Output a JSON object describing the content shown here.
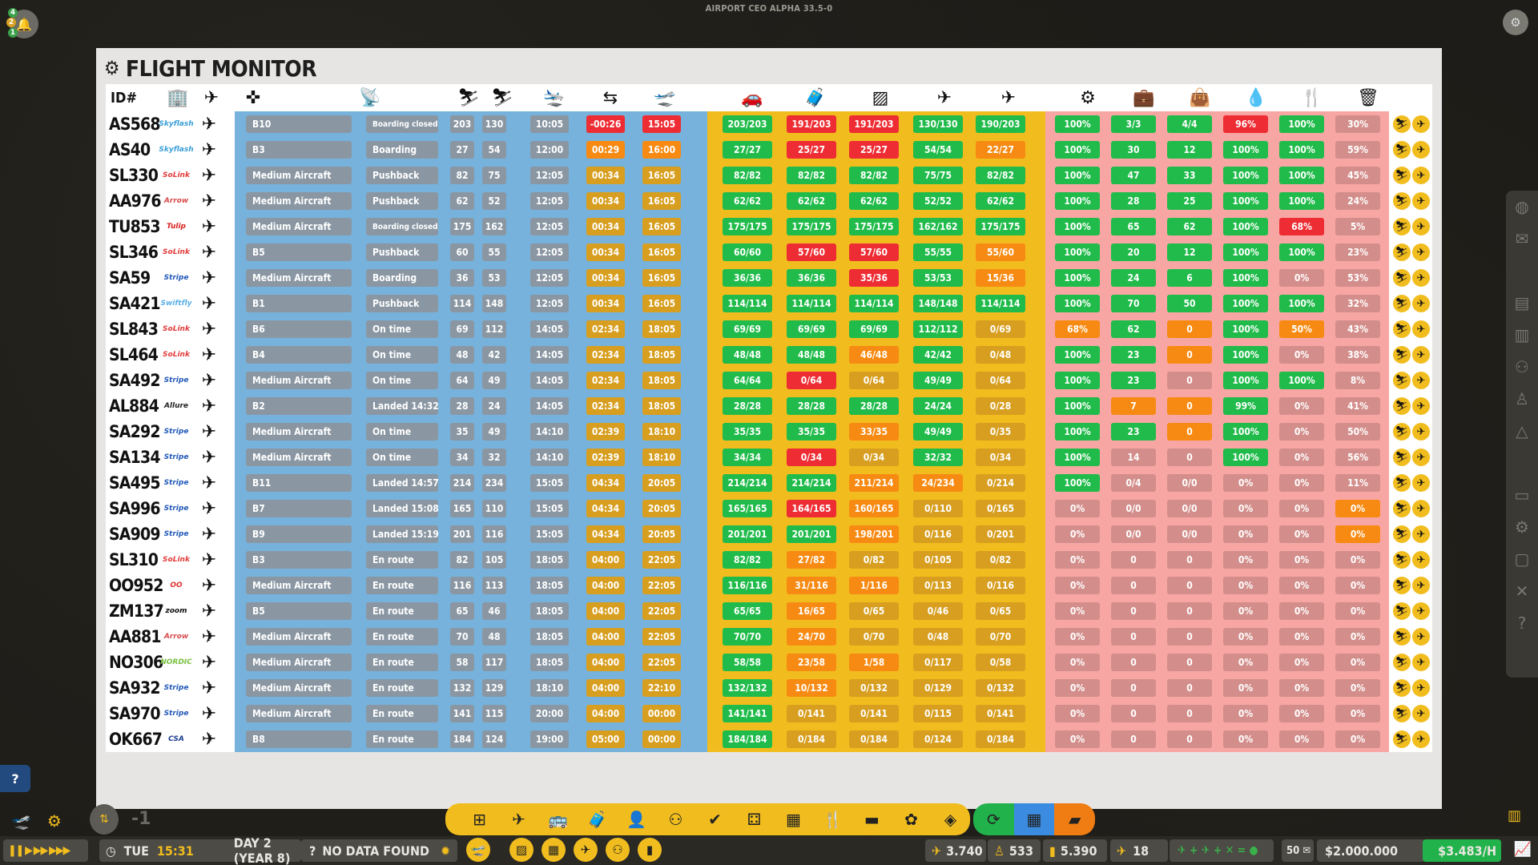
{
  "app": {
    "version_label": "AIRPORT CEO ALPHA 33.5-0"
  },
  "panel": {
    "title": "FLIGHT MONITOR"
  },
  "header": {
    "id_label": "ID#"
  },
  "columns_icons": [
    "terminal-icon",
    "aircraft-type-icon",
    "stand-icon",
    "satellite-icon",
    "passengers-boarding-icon",
    "passengers-deboarding-icon",
    "arrival-icon",
    "turnaround-icon",
    "departure-icon",
    "car-icon",
    "baggage-icon",
    "cleaning-icon",
    "refuel-icon",
    "catering-icon",
    "service-cog-icon",
    "suitcase-icon",
    "bag-icon",
    "fuel-drop-icon",
    "cutlery-icon",
    "trash-icon"
  ],
  "flights": [
    {
      "id": "AS568",
      "airline": "Skyflash",
      "stand": "B10",
      "status": "Boarding closed",
      "pax_in": "203",
      "pax_out": "130",
      "arr": "10:05",
      "turn": "-00:26",
      "dep": "15:05",
      "c1": "203/203",
      "c2": "191/203",
      "c3": "191/203",
      "c4": "130/130",
      "c5": "190/203",
      "s1": "100%",
      "s2": "3/3",
      "s3": "4/4",
      "s4": "96%",
      "s5": "100%",
      "s6": "30%",
      "st": [
        "g",
        "g",
        "g",
        "g",
        "g",
        "bad",
        "bad",
        "ok",
        "bad",
        "bad",
        "ok",
        "ok",
        "ok",
        "ok",
        "ok",
        "bad",
        "ok",
        "gv"
      ]
    },
    {
      "id": "AS40",
      "airline": "Skyflash",
      "stand": "B3",
      "status": "Boarding",
      "pax_in": "27",
      "pax_out": "54",
      "arr": "12:00",
      "turn": "00:29",
      "dep": "16:00",
      "c1": "27/27",
      "c2": "25/27",
      "c3": "25/27",
      "c4": "54/54",
      "c5": "22/27",
      "s1": "100%",
      "s2": "30",
      "s3": "12",
      "s4": "100%",
      "s5": "100%",
      "s6": "59%",
      "st": [
        "g",
        "g",
        "g",
        "g",
        "g",
        "warn",
        "warn",
        "ok",
        "bad",
        "bad",
        "ok",
        "warn",
        "ok",
        "ok",
        "ok",
        "ok",
        "ok",
        "gv"
      ]
    },
    {
      "id": "SL330",
      "airline": "SoLink",
      "stand": "Medium Aircraft",
      "status": "Pushback",
      "pax_in": "82",
      "pax_out": "75",
      "arr": "12:05",
      "turn": "00:34",
      "dep": "16:05",
      "c1": "82/82",
      "c2": "82/82",
      "c3": "82/82",
      "c4": "75/75",
      "c5": "82/82",
      "s1": "100%",
      "s2": "47",
      "s3": "33",
      "s4": "100%",
      "s5": "100%",
      "s6": "45%",
      "st": [
        "g",
        "g",
        "g",
        "g",
        "g",
        "gy",
        "gy",
        "ok",
        "ok",
        "ok",
        "ok",
        "ok",
        "ok",
        "ok",
        "ok",
        "ok",
        "ok",
        "gv"
      ]
    },
    {
      "id": "AA976",
      "airline": "Arrow",
      "stand": "Medium Aircraft",
      "status": "Pushback",
      "pax_in": "62",
      "pax_out": "52",
      "arr": "12:05",
      "turn": "00:34",
      "dep": "16:05",
      "c1": "62/62",
      "c2": "62/62",
      "c3": "62/62",
      "c4": "52/52",
      "c5": "62/62",
      "s1": "100%",
      "s2": "28",
      "s3": "25",
      "s4": "100%",
      "s5": "100%",
      "s6": "24%",
      "st": [
        "g",
        "g",
        "g",
        "g",
        "g",
        "gy",
        "gy",
        "ok",
        "ok",
        "ok",
        "ok",
        "ok",
        "ok",
        "ok",
        "ok",
        "ok",
        "ok",
        "gv"
      ]
    },
    {
      "id": "TU853",
      "airline": "Tulip",
      "stand": "Medium Aircraft",
      "status": "Boarding closed",
      "pax_in": "175",
      "pax_out": "162",
      "arr": "12:05",
      "turn": "00:34",
      "dep": "16:05",
      "c1": "175/175",
      "c2": "175/175",
      "c3": "175/175",
      "c4": "162/162",
      "c5": "175/175",
      "s1": "100%",
      "s2": "65",
      "s3": "62",
      "s4": "100%",
      "s5": "68%",
      "s6": "5%",
      "st": [
        "g",
        "g",
        "g",
        "g",
        "g",
        "gy",
        "gy",
        "ok",
        "ok",
        "ok",
        "ok",
        "ok",
        "ok",
        "ok",
        "ok",
        "ok",
        "bad",
        "gv"
      ]
    },
    {
      "id": "SL346",
      "airline": "SoLink",
      "stand": "B5",
      "status": "Pushback",
      "pax_in": "60",
      "pax_out": "55",
      "arr": "12:05",
      "turn": "00:34",
      "dep": "16:05",
      "c1": "60/60",
      "c2": "57/60",
      "c3": "57/60",
      "c4": "55/55",
      "c5": "55/60",
      "s1": "100%",
      "s2": "20",
      "s3": "12",
      "s4": "100%",
      "s5": "100%",
      "s6": "23%",
      "st": [
        "g",
        "g",
        "g",
        "g",
        "g",
        "gy",
        "gy",
        "ok",
        "bad",
        "bad",
        "ok",
        "warn",
        "ok",
        "ok",
        "ok",
        "ok",
        "ok",
        "gv"
      ]
    },
    {
      "id": "SA59",
      "airline": "Stripe",
      "stand": "Medium Aircraft",
      "status": "Boarding",
      "pax_in": "36",
      "pax_out": "53",
      "arr": "12:05",
      "turn": "00:34",
      "dep": "16:05",
      "c1": "36/36",
      "c2": "36/36",
      "c3": "35/36",
      "c4": "53/53",
      "c5": "15/36",
      "s1": "100%",
      "s2": "24",
      "s3": "6",
      "s4": "100%",
      "s5": "0%",
      "s6": "53%",
      "st": [
        "g",
        "g",
        "g",
        "g",
        "g",
        "gy",
        "gy",
        "ok",
        "ok",
        "bad",
        "ok",
        "warn",
        "ok",
        "ok",
        "ok",
        "ok",
        "gv",
        "gv"
      ]
    },
    {
      "id": "SA421",
      "airline": "Swiftfly",
      "stand": "B1",
      "status": "Pushback",
      "pax_in": "114",
      "pax_out": "148",
      "arr": "12:05",
      "turn": "00:34",
      "dep": "16:05",
      "c1": "114/114",
      "c2": "114/114",
      "c3": "114/114",
      "c4": "148/148",
      "c5": "114/114",
      "s1": "100%",
      "s2": "70",
      "s3": "50",
      "s4": "100%",
      "s5": "100%",
      "s6": "32%",
      "st": [
        "g",
        "g",
        "g",
        "g",
        "g",
        "gy",
        "gy",
        "ok",
        "ok",
        "ok",
        "ok",
        "ok",
        "ok",
        "ok",
        "ok",
        "ok",
        "ok",
        "gv"
      ]
    },
    {
      "id": "SL843",
      "airline": "SoLink",
      "stand": "B6",
      "status": "On time",
      "pax_in": "69",
      "pax_out": "112",
      "arr": "14:05",
      "turn": "02:34",
      "dep": "18:05",
      "c1": "69/69",
      "c2": "69/69",
      "c3": "69/69",
      "c4": "112/112",
      "c5": "0/69",
      "s1": "68%",
      "s2": "62",
      "s3": "0",
      "s4": "100%",
      "s5": "50%",
      "s6": "43%",
      "st": [
        "g",
        "g",
        "g",
        "g",
        "g",
        "gy",
        "gy",
        "ok",
        "ok",
        "ok",
        "ok",
        "gy",
        "warn",
        "ok",
        "warn",
        "ok",
        "warn",
        "gv"
      ]
    },
    {
      "id": "SL464",
      "airline": "SoLink",
      "stand": "B4",
      "status": "On time",
      "pax_in": "48",
      "pax_out": "42",
      "arr": "14:05",
      "turn": "02:34",
      "dep": "18:05",
      "c1": "48/48",
      "c2": "48/48",
      "c3": "46/48",
      "c4": "42/42",
      "c5": "0/48",
      "s1": "100%",
      "s2": "23",
      "s3": "0",
      "s4": "100%",
      "s5": "0%",
      "s6": "38%",
      "st": [
        "g",
        "g",
        "g",
        "g",
        "g",
        "gy",
        "gy",
        "ok",
        "ok",
        "warn",
        "ok",
        "gy",
        "ok",
        "ok",
        "warn",
        "ok",
        "gv",
        "gv"
      ]
    },
    {
      "id": "SA492",
      "airline": "Stripe",
      "stand": "Medium Aircraft",
      "status": "On time",
      "pax_in": "64",
      "pax_out": "49",
      "arr": "14:05",
      "turn": "02:34",
      "dep": "18:05",
      "c1": "64/64",
      "c2": "0/64",
      "c3": "0/64",
      "c4": "49/49",
      "c5": "0/64",
      "s1": "100%",
      "s2": "23",
      "s3": "0",
      "s4": "100%",
      "s5": "100%",
      "s6": "8%",
      "st": [
        "g",
        "g",
        "g",
        "g",
        "g",
        "gy",
        "gy",
        "ok",
        "bad",
        "gy",
        "ok",
        "gy",
        "ok",
        "ok",
        "gv",
        "ok",
        "ok",
        "gv"
      ]
    },
    {
      "id": "AL884",
      "airline": "Allure",
      "stand": "B2",
      "status": "Landed  14:32",
      "pax_in": "28",
      "pax_out": "24",
      "arr": "14:05",
      "turn": "02:34",
      "dep": "18:05",
      "c1": "28/28",
      "c2": "28/28",
      "c3": "28/28",
      "c4": "24/24",
      "c5": "0/28",
      "s1": "100%",
      "s2": "7",
      "s3": "0",
      "s4": "99%",
      "s5": "0%",
      "s6": "41%",
      "st": [
        "g",
        "g",
        "g",
        "g",
        "g",
        "gy",
        "gy",
        "ok",
        "ok",
        "ok",
        "ok",
        "gy",
        "ok",
        "warn",
        "warn",
        "ok",
        "gv",
        "gv"
      ]
    },
    {
      "id": "SA292",
      "airline": "Stripe",
      "stand": "Medium Aircraft",
      "status": "On time",
      "pax_in": "35",
      "pax_out": "49",
      "arr": "14:10",
      "turn": "02:39",
      "dep": "18:10",
      "c1": "35/35",
      "c2": "35/35",
      "c3": "33/35",
      "c4": "49/49",
      "c5": "0/35",
      "s1": "100%",
      "s2": "23",
      "s3": "0",
      "s4": "100%",
      "s5": "0%",
      "s6": "50%",
      "st": [
        "g",
        "g",
        "g",
        "g",
        "g",
        "gy",
        "gy",
        "ok",
        "ok",
        "warn",
        "ok",
        "gy",
        "ok",
        "ok",
        "warn",
        "ok",
        "gv",
        "gv"
      ]
    },
    {
      "id": "SA134",
      "airline": "Stripe",
      "stand": "Medium Aircraft",
      "status": "On time",
      "pax_in": "34",
      "pax_out": "32",
      "arr": "14:10",
      "turn": "02:39",
      "dep": "18:10",
      "c1": "34/34",
      "c2": "0/34",
      "c3": "0/34",
      "c4": "32/32",
      "c5": "0/34",
      "s1": "100%",
      "s2": "14",
      "s3": "0",
      "s4": "100%",
      "s5": "0%",
      "s6": "56%",
      "st": [
        "g",
        "g",
        "g",
        "g",
        "g",
        "gy",
        "gy",
        "ok",
        "bad",
        "gy",
        "ok",
        "gy",
        "ok",
        "gv",
        "gv",
        "ok",
        "gv",
        "gv"
      ]
    },
    {
      "id": "SA495",
      "airline": "Stripe",
      "stand": "B11",
      "status": "Landed  14:57",
      "pax_in": "214",
      "pax_out": "234",
      "arr": "15:05",
      "turn": "04:34",
      "dep": "20:05",
      "c1": "214/214",
      "c2": "214/214",
      "c3": "211/214",
      "c4": "24/234",
      "c5": "0/214",
      "s1": "100%",
      "s2": "0/4",
      "s3": "0/0",
      "s4": "0%",
      "s5": "0%",
      "s6": "11%",
      "st": [
        "g",
        "g",
        "g",
        "g",
        "g",
        "gy",
        "gy",
        "ok",
        "ok",
        "warn",
        "warn",
        "gy",
        "ok",
        "gv",
        "gv",
        "gv",
        "gv",
        "gv"
      ]
    },
    {
      "id": "SA996",
      "airline": "Stripe",
      "stand": "B7",
      "status": "Landed  15:08",
      "pax_in": "165",
      "pax_out": "110",
      "arr": "15:05",
      "turn": "04:34",
      "dep": "20:05",
      "c1": "165/165",
      "c2": "164/165",
      "c3": "160/165",
      "c4": "0/110",
      "c5": "0/165",
      "s1": "0%",
      "s2": "0/0",
      "s3": "0/0",
      "s4": "0%",
      "s5": "0%",
      "s6": "0%",
      "st": [
        "g",
        "g",
        "g",
        "g",
        "g",
        "gy",
        "gy",
        "ok",
        "bad",
        "warn",
        "gy",
        "gy",
        "gv",
        "gv",
        "gv",
        "gv",
        "gv",
        "warn"
      ]
    },
    {
      "id": "SA909",
      "airline": "Stripe",
      "stand": "B9",
      "status": "Landed  15:19",
      "pax_in": "201",
      "pax_out": "116",
      "arr": "15:05",
      "turn": "04:34",
      "dep": "20:05",
      "c1": "201/201",
      "c2": "201/201",
      "c3": "198/201",
      "c4": "0/116",
      "c5": "0/201",
      "s1": "0%",
      "s2": "0/0",
      "s3": "0/0",
      "s4": "0%",
      "s5": "0%",
      "s6": "0%",
      "st": [
        "g",
        "g",
        "g",
        "g",
        "g",
        "gy",
        "gy",
        "ok",
        "ok",
        "warn",
        "gy",
        "gy",
        "gv",
        "gv",
        "gv",
        "gv",
        "gv",
        "warn"
      ]
    },
    {
      "id": "SL310",
      "airline": "SoLink",
      "stand": "B3",
      "status": "En route",
      "pax_in": "82",
      "pax_out": "105",
      "arr": "18:05",
      "turn": "04:00",
      "dep": "22:05",
      "c1": "82/82",
      "c2": "27/82",
      "c3": "0/82",
      "c4": "0/105",
      "c5": "0/82",
      "s1": "0%",
      "s2": "0",
      "s3": "0",
      "s4": "0%",
      "s5": "0%",
      "s6": "0%",
      "st": [
        "g",
        "g",
        "g",
        "g",
        "g",
        "gy",
        "gy",
        "ok",
        "warn",
        "gy",
        "gy",
        "gy",
        "gv",
        "gv",
        "gv",
        "gv",
        "gv",
        "gv"
      ]
    },
    {
      "id": "OO952",
      "airline": "OO",
      "stand": "Medium Aircraft",
      "status": "En route",
      "pax_in": "116",
      "pax_out": "113",
      "arr": "18:05",
      "turn": "04:00",
      "dep": "22:05",
      "c1": "116/116",
      "c2": "31/116",
      "c3": "1/116",
      "c4": "0/113",
      "c5": "0/116",
      "s1": "0%",
      "s2": "0",
      "s3": "0",
      "s4": "0%",
      "s5": "0%",
      "s6": "0%",
      "st": [
        "g",
        "g",
        "g",
        "g",
        "g",
        "gy",
        "gy",
        "ok",
        "warn",
        "warn",
        "gy",
        "gy",
        "gv",
        "gv",
        "gv",
        "gv",
        "gv",
        "gv"
      ]
    },
    {
      "id": "ZM137",
      "airline": "zoom",
      "stand": "B5",
      "status": "En route",
      "pax_in": "65",
      "pax_out": "46",
      "arr": "18:05",
      "turn": "04:00",
      "dep": "22:05",
      "c1": "65/65",
      "c2": "16/65",
      "c3": "0/65",
      "c4": "0/46",
      "c5": "0/65",
      "s1": "0%",
      "s2": "0",
      "s3": "0",
      "s4": "0%",
      "s5": "0%",
      "s6": "0%",
      "st": [
        "g",
        "g",
        "g",
        "g",
        "g",
        "gy",
        "gy",
        "ok",
        "warn",
        "gy",
        "gy",
        "gy",
        "gv",
        "gv",
        "gv",
        "gv",
        "gv",
        "gv"
      ]
    },
    {
      "id": "AA881",
      "airline": "Arrow",
      "stand": "Medium Aircraft",
      "status": "En route",
      "pax_in": "70",
      "pax_out": "48",
      "arr": "18:05",
      "turn": "04:00",
      "dep": "22:05",
      "c1": "70/70",
      "c2": "24/70",
      "c3": "0/70",
      "c4": "0/48",
      "c5": "0/70",
      "s1": "0%",
      "s2": "0",
      "s3": "0",
      "s4": "0%",
      "s5": "0%",
      "s6": "0%",
      "st": [
        "g",
        "g",
        "g",
        "g",
        "g",
        "gy",
        "gy",
        "ok",
        "warn",
        "gy",
        "gy",
        "gy",
        "gv",
        "gv",
        "gv",
        "gv",
        "gv",
        "gv"
      ]
    },
    {
      "id": "NO306",
      "airline": "NORDIC",
      "stand": "Medium Aircraft",
      "status": "En route",
      "pax_in": "58",
      "pax_out": "117",
      "arr": "18:05",
      "turn": "04:00",
      "dep": "22:05",
      "c1": "58/58",
      "c2": "23/58",
      "c3": "1/58",
      "c4": "0/117",
      "c5": "0/58",
      "s1": "0%",
      "s2": "0",
      "s3": "0",
      "s4": "0%",
      "s5": "0%",
      "s6": "0%",
      "st": [
        "g",
        "g",
        "g",
        "g",
        "g",
        "gy",
        "gy",
        "ok",
        "warn",
        "warn",
        "gy",
        "gy",
        "gv",
        "gv",
        "gv",
        "gv",
        "gv",
        "gv"
      ]
    },
    {
      "id": "SA932",
      "airline": "Stripe",
      "stand": "Medium Aircraft",
      "status": "En route",
      "pax_in": "132",
      "pax_out": "129",
      "arr": "18:10",
      "turn": "04:00",
      "dep": "22:10",
      "c1": "132/132",
      "c2": "10/132",
      "c3": "0/132",
      "c4": "0/129",
      "c5": "0/132",
      "s1": "0%",
      "s2": "0",
      "s3": "0",
      "s4": "0%",
      "s5": "0%",
      "s6": "0%",
      "st": [
        "g",
        "g",
        "g",
        "g",
        "g",
        "gy",
        "gy",
        "ok",
        "warn",
        "gy",
        "gy",
        "gy",
        "gv",
        "gv",
        "gv",
        "gv",
        "gv",
        "gv"
      ]
    },
    {
      "id": "SA970",
      "airline": "Stripe",
      "stand": "Medium Aircraft",
      "status": "En route",
      "pax_in": "141",
      "pax_out": "115",
      "arr": "20:00",
      "turn": "04:00",
      "dep": "00:00",
      "c1": "141/141",
      "c2": "0/141",
      "c3": "0/141",
      "c4": "0/115",
      "c5": "0/141",
      "s1": "0%",
      "s2": "0",
      "s3": "0",
      "s4": "0%",
      "s5": "0%",
      "s6": "0%",
      "st": [
        "g",
        "g",
        "g",
        "g",
        "g",
        "gy",
        "gy",
        "ok",
        "gy",
        "gy",
        "gy",
        "gy",
        "gv",
        "gv",
        "gv",
        "gv",
        "gv",
        "gv"
      ]
    },
    {
      "id": "OK667",
      "airline": "CSA",
      "stand": "B8",
      "status": "En route",
      "pax_in": "184",
      "pax_out": "124",
      "arr": "19:00",
      "turn": "05:00",
      "dep": "00:00",
      "c1": "184/184",
      "c2": "0/184",
      "c3": "0/184",
      "c4": "0/124",
      "c5": "0/184",
      "s1": "0%",
      "s2": "0",
      "s3": "0",
      "s4": "0%",
      "s5": "0%",
      "s6": "0%",
      "st": [
        "g",
        "g",
        "g",
        "g",
        "g",
        "gy",
        "gy",
        "ok",
        "gy",
        "gy",
        "gy",
        "gy",
        "gv",
        "gv",
        "gv",
        "gv",
        "gv",
        "gv"
      ]
    }
  ],
  "airline_colors": {
    "Skyflash": "#3b9fd8",
    "SoLink": "#e23a3a",
    "Arrow": "#d84a4a",
    "Tulip": "#d81e1e",
    "Stripe": "#2158b8",
    "Swiftfly": "#5ab0e8",
    "Allure": "#222222",
    "OO": "#e33333",
    "zoom": "#111111",
    "NORDIC": "#7ac142",
    "CSA": "#1a3d8f"
  },
  "statusbar": {
    "day": "TUE",
    "time": "15:31",
    "date": "DAY 2 (YEAR 8)",
    "no_data": "NO DATA FOUND",
    "stat1": "3.740",
    "stat2": "533",
    "stat3": "5.390",
    "stat4": "18",
    "mail_count": "50",
    "money": "$2.000.000",
    "rate": "$3.483/H"
  },
  "help_label": "?",
  "speed_offset": "-1"
}
